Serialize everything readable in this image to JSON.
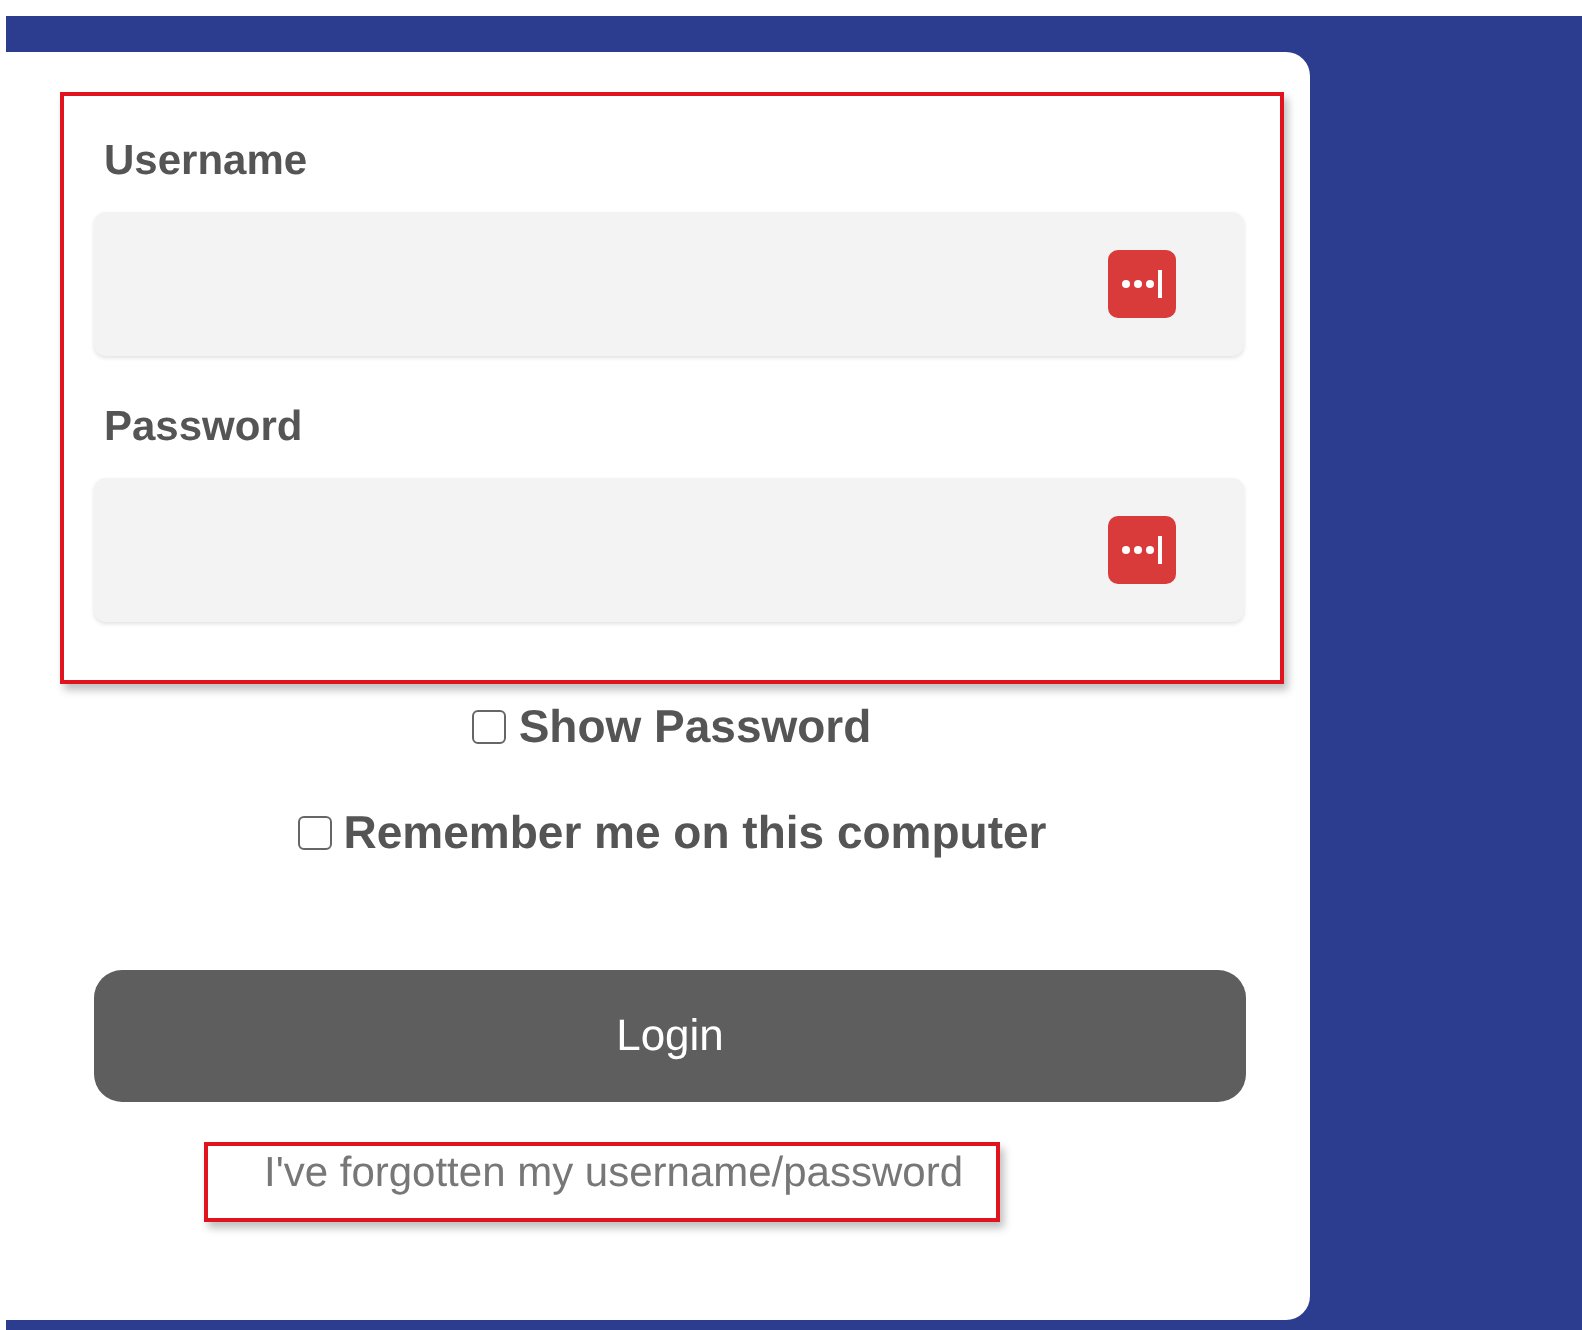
{
  "fields": [
    {
      "label": "Username"
    },
    {
      "label": "Password"
    }
  ],
  "checkboxes": [
    {
      "label": "Show Password",
      "checked": false
    },
    {
      "label": "Remember me on this computer",
      "checked": false
    }
  ],
  "login_button": {
    "label": "Login"
  },
  "forgot_link": {
    "label": "I've forgotten my username/password"
  }
}
